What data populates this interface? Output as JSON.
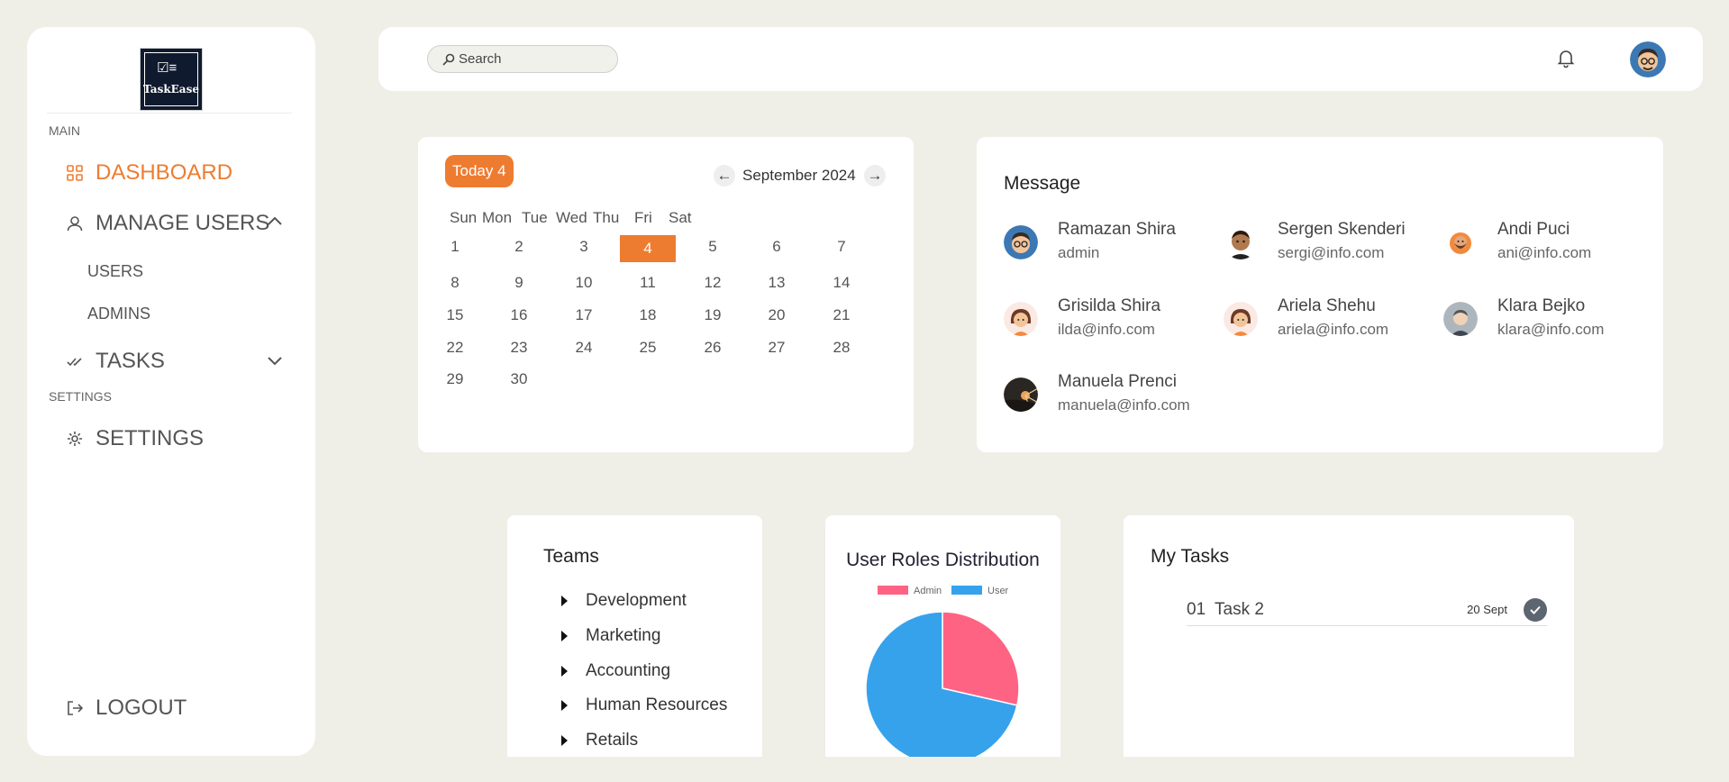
{
  "brand": {
    "logo_text": "TaskEase"
  },
  "sidebar": {
    "main_label": "MAIN",
    "dashboard": "DASHBOARD",
    "manage_users": "MANAGE USERS",
    "users": "USERS",
    "admins": "ADMINS",
    "tasks": "TASKS",
    "settings_label": "SETTINGS",
    "settings": "SETTINGS",
    "logout": "LOGOUT"
  },
  "header": {
    "search_placeholder": "Search"
  },
  "calendar": {
    "today_label": "Today 4",
    "month_label": "September 2024",
    "prev": "←",
    "next": "→",
    "weekdays": [
      "Sun",
      "Mon",
      "Tue",
      "Wed",
      "Thu",
      "Fri",
      "Sat"
    ],
    "weeks": [
      [
        "1",
        "2",
        "3",
        "4",
        "5",
        "6",
        "7"
      ],
      [
        "8",
        "9",
        "10",
        "11",
        "12",
        "13",
        "14"
      ],
      [
        "15",
        "16",
        "17",
        "18",
        "19",
        "20",
        "21"
      ],
      [
        "22",
        "23",
        "24",
        "25",
        "26",
        "27",
        "28"
      ],
      [
        "29",
        "30",
        "",
        "",
        "",
        "",
        ""
      ]
    ],
    "selected": "4"
  },
  "messages": {
    "title": "Message",
    "contacts": [
      {
        "name": "Ramazan Shira",
        "email": "admin"
      },
      {
        "name": "Sergen Skenderi",
        "email": "sergi@info.com"
      },
      {
        "name": "Andi Puci",
        "email": "ani@info.com"
      },
      {
        "name": "Grisilda Shira",
        "email": "ilda@info.com"
      },
      {
        "name": "Ariela Shehu",
        "email": "ariela@info.com"
      },
      {
        "name": "Klara Bejko",
        "email": "klara@info.com"
      },
      {
        "name": "Manuela Prenci",
        "email": "manuela@info.com"
      }
    ]
  },
  "teams": {
    "title": "Teams",
    "items": [
      "Development",
      "Marketing",
      "Accounting",
      "Human Resources",
      "Retails"
    ]
  },
  "chart_data": {
    "type": "pie",
    "title": "User Roles Distribution",
    "categories": [
      "Admin",
      "User"
    ],
    "values": [
      2,
      5
    ],
    "colors": [
      "#ff6384",
      "#36a2eb"
    ],
    "legend": "top"
  },
  "tasks": {
    "title": "My Tasks",
    "items": [
      {
        "number": "01",
        "name": "Task 2",
        "date": "20 Sept"
      }
    ]
  },
  "colors": {
    "accent": "#ee7c30",
    "background": "#efeee7"
  }
}
